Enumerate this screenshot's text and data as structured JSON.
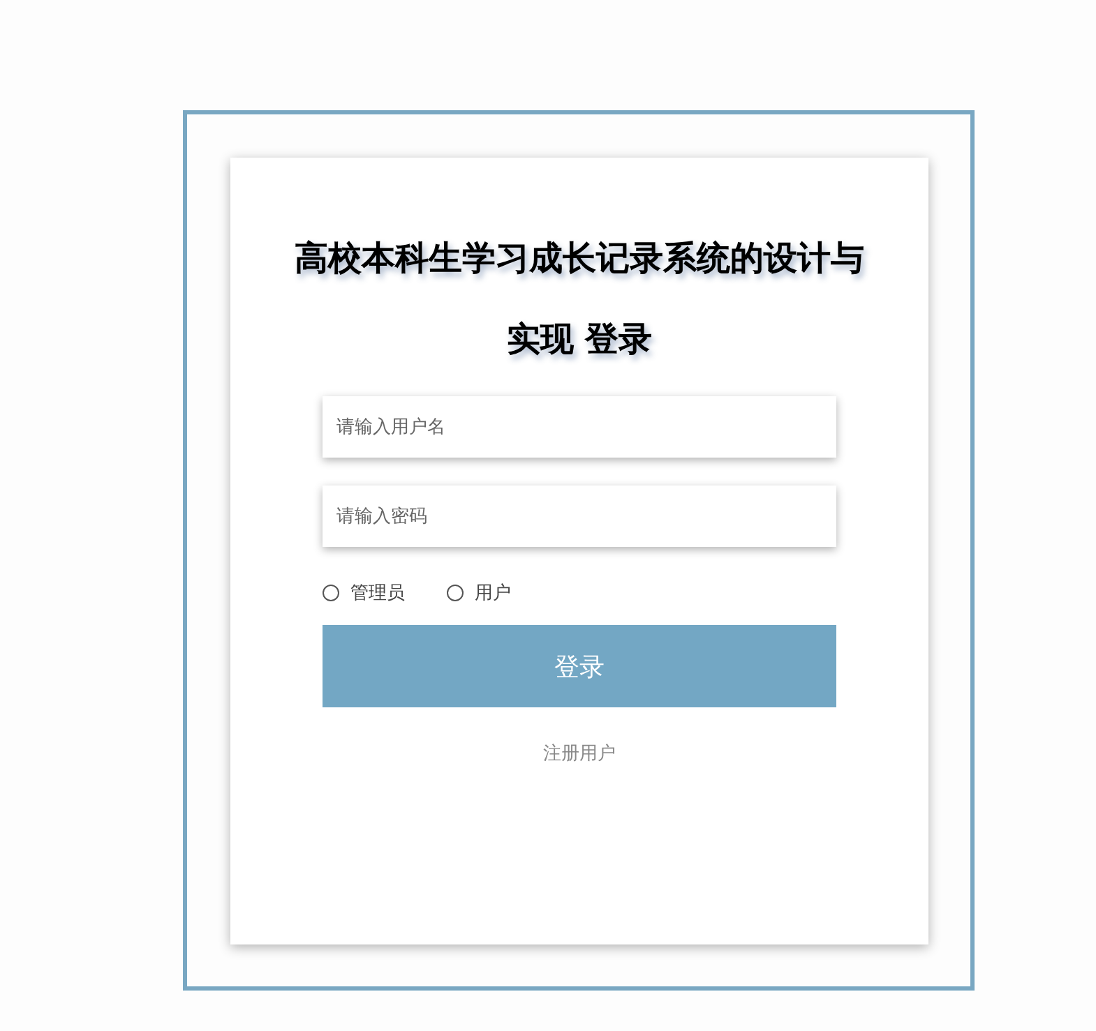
{
  "title_lines": [
    "高校本科生学习成长记录系统的设计与",
    "实现 登录"
  ],
  "fields": [
    {
      "placeholder": "请输入用户名"
    },
    {
      "placeholder": "请输入密码"
    }
  ],
  "roles": [
    {
      "label": "管理员",
      "selected": false
    },
    {
      "label": "用户",
      "selected": false
    }
  ],
  "login_button": "登录",
  "register_link": "注册用户"
}
